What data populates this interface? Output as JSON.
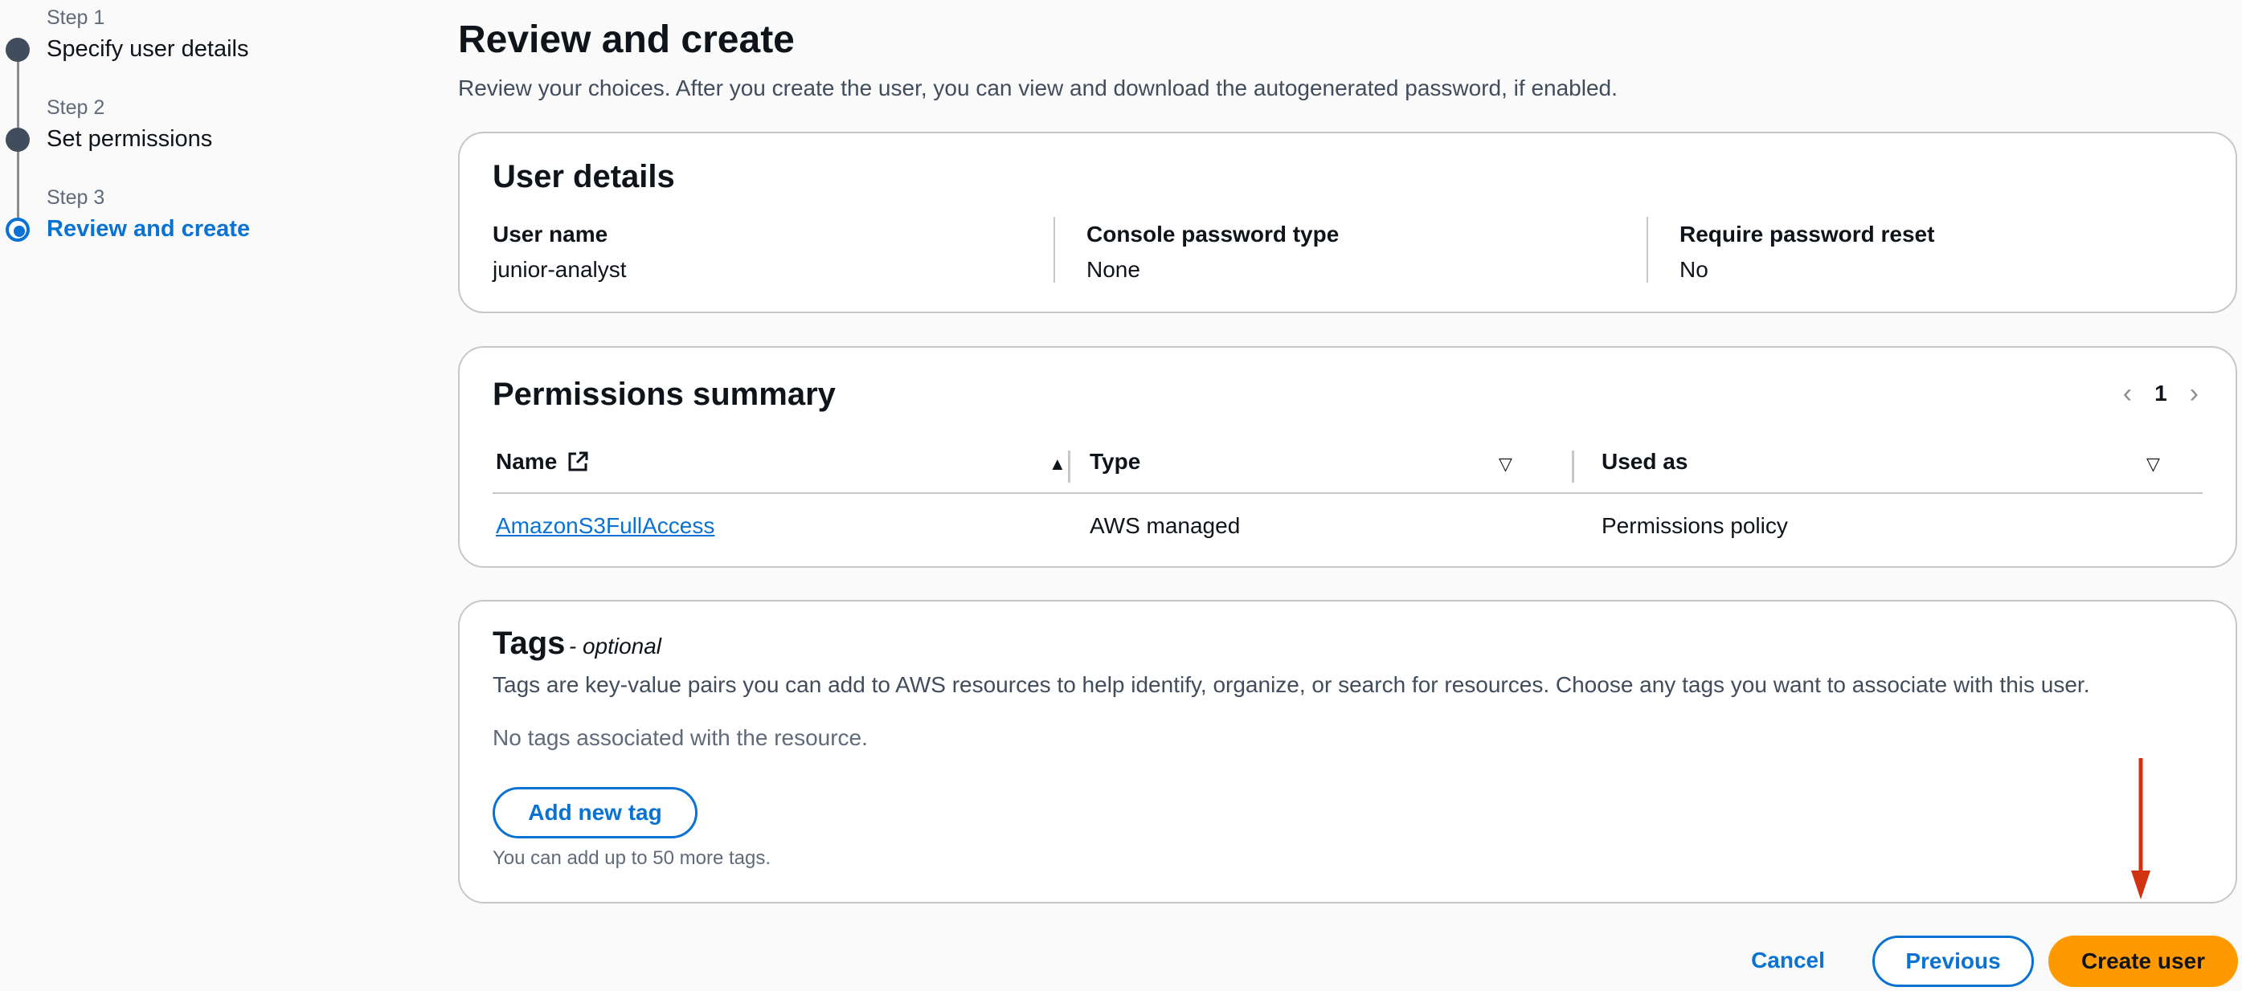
{
  "stepper": {
    "steps": [
      {
        "number": "Step 1",
        "title": "Specify user details"
      },
      {
        "number": "Step 2",
        "title": "Set permissions"
      },
      {
        "number": "Step 3",
        "title": "Review and create"
      }
    ]
  },
  "header": {
    "title": "Review and create",
    "description": "Review your choices. After you create the user, you can view and download the autogenerated password, if enabled."
  },
  "user_details": {
    "title": "User details",
    "fields": [
      {
        "label": "User name",
        "value": "junior-analyst"
      },
      {
        "label": "Console password type",
        "value": "None"
      },
      {
        "label": "Require password reset",
        "value": "No"
      }
    ]
  },
  "permissions": {
    "title": "Permissions summary",
    "current_page": "1",
    "columns": [
      "Name",
      "Type",
      "Used as"
    ],
    "rows": [
      {
        "name": "AmazonS3FullAccess",
        "type": "AWS managed",
        "used_as": "Permissions policy"
      }
    ]
  },
  "tags": {
    "title": "Tags",
    "optional": "- optional",
    "description": "Tags are key-value pairs you can add to AWS resources to help identify, organize, or search for resources. Choose any tags you want to associate with this user.",
    "empty_text": "No tags associated with the resource.",
    "add_label": "Add new tag",
    "hint": "You can add up to 50 more tags."
  },
  "footer": {
    "cancel": "Cancel",
    "previous": "Previous",
    "create": "Create user"
  },
  "colors": {
    "accent": "#0972d3",
    "primary_button": "#ff9900",
    "annotation_arrow": "#d13212"
  }
}
